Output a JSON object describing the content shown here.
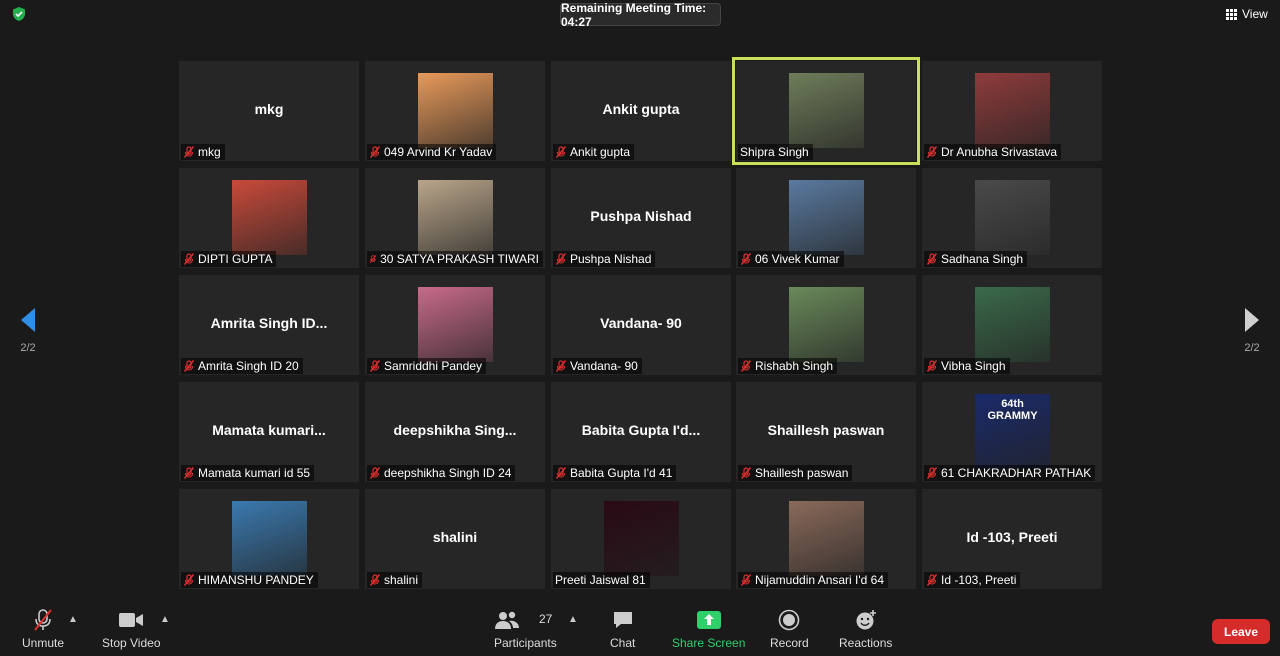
{
  "timer": {
    "label": "Remaining Meeting Time: 04:27"
  },
  "view": {
    "label": "View"
  },
  "pagination": {
    "left": "2/2",
    "right": "2/2"
  },
  "tiles": [
    {
      "big": "mkg",
      "name": "mkg",
      "muted": true,
      "avatar": null
    },
    {
      "big": "",
      "name": "049 Arvind Kr Yadav",
      "muted": true,
      "avatar": "#e89a5a"
    },
    {
      "big": "Ankit gupta",
      "name": "Ankit gupta",
      "muted": true,
      "avatar": null
    },
    {
      "big": "",
      "name": "Shipra Singh",
      "muted": false,
      "avatar": "#6f7d5a",
      "active": true
    },
    {
      "big": "",
      "name": "Dr Anubha Srivastava",
      "muted": true,
      "avatar": "#8f3b3b"
    },
    {
      "big": "",
      "name": "DIPTI GUPTA",
      "muted": true,
      "avatar": "#c94a3a"
    },
    {
      "big": "",
      "name": "30 SATYA PRAKASH TIWARI",
      "muted": true,
      "avatar": "#b9a58a"
    },
    {
      "big": "Pushpa Nishad",
      "name": "Pushpa Nishad",
      "muted": true,
      "avatar": null
    },
    {
      "big": "",
      "name": "06 Vivek Kumar",
      "muted": true,
      "avatar": "#5a7aa0"
    },
    {
      "big": "",
      "name": "Sadhana Singh",
      "muted": true,
      "avatar": "#4a4a4a"
    },
    {
      "big": "Amrita Singh ID...",
      "name": "Amrita Singh ID 20",
      "muted": true,
      "avatar": null
    },
    {
      "big": "",
      "name": "Samriddhi Pandey",
      "muted": true,
      "avatar": "#c86a8a"
    },
    {
      "big": "Vandana- 90",
      "name": "Vandana- 90",
      "muted": true,
      "avatar": null
    },
    {
      "big": "",
      "name": "Rishabh Singh",
      "muted": true,
      "avatar": "#6a8a5a"
    },
    {
      "big": "",
      "name": "Vibha Singh",
      "muted": true,
      "avatar": "#3a6a4a"
    },
    {
      "big": "Mamata kumari...",
      "name": "Mamata kumari id 55",
      "muted": true,
      "avatar": null
    },
    {
      "big": "deepshikha Sing...",
      "name": "deepshikha Singh ID 24",
      "muted": true,
      "avatar": null
    },
    {
      "big": "Babita Gupta I'd...",
      "name": "Babita Gupta I'd 41",
      "muted": true,
      "avatar": null
    },
    {
      "big": "Shaillesh paswan",
      "name": "Shaillesh paswan",
      "muted": true,
      "avatar": null
    },
    {
      "big": "",
      "name": "61 CHAKRADHAR PATHAK",
      "muted": true,
      "avatar": "#1a2a6a",
      "poster": "64th GRAMMY"
    },
    {
      "big": "",
      "name": "HIMANSHU PANDEY",
      "muted": true,
      "avatar": "#3a7ab0"
    },
    {
      "big": "shalini",
      "name": "shalini",
      "muted": true,
      "avatar": null
    },
    {
      "big": "",
      "name": "Preeti Jaiswal 81",
      "muted": false,
      "avatar": "#2a0a14"
    },
    {
      "big": "",
      "name": "Nijamuddin Ansari I'd 64",
      "muted": true,
      "avatar": "#8a6a5a"
    },
    {
      "big": "Id -103, Preeti",
      "name": "Id -103, Preeti",
      "muted": true,
      "avatar": null
    }
  ],
  "toolbar": {
    "unmute": "Unmute",
    "stop_video": "Stop Video",
    "participants": "Participants",
    "participants_count": "27",
    "chat": "Chat",
    "share_screen": "Share Screen",
    "record": "Record",
    "reactions": "Reactions",
    "leave": "Leave"
  },
  "colors": {
    "accent_green": "#2fd06a",
    "active_border": "#c8e05a",
    "leave_red": "#d52b2b",
    "nav_blue": "#2f8fe8"
  }
}
